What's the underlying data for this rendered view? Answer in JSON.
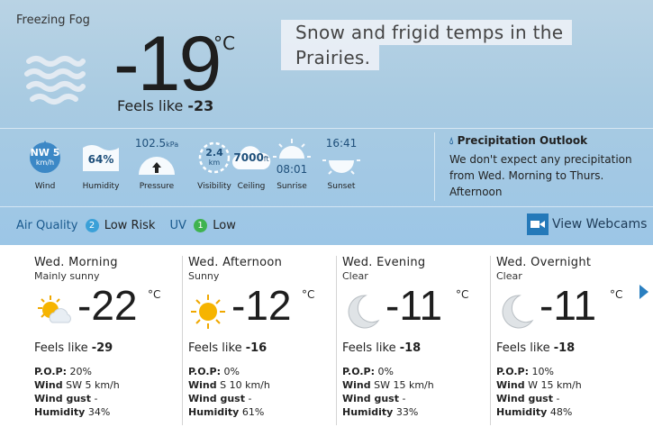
{
  "current": {
    "condition": "Freezing Fog",
    "temperature": "-19",
    "unit": "°C",
    "feels_like_label": "Feels like",
    "feels_like_value": "-23",
    "icon": "fog-icon"
  },
  "headline": {
    "line1": "Snow and frigid temps in the",
    "line2": "Prairies."
  },
  "stats": {
    "wind": {
      "value": "NW 5",
      "unit": "km/h",
      "label": "Wind"
    },
    "humidity": {
      "value": "64%",
      "label": "Humidity"
    },
    "pressure": {
      "value": "102.5",
      "unit": "kPa",
      "label": "Pressure",
      "trend": "rising"
    },
    "visibility": {
      "value": "2.4",
      "unit": "km",
      "label": "Visibility"
    },
    "ceiling": {
      "value": "7000",
      "unit": "ft",
      "label": "Ceiling"
    },
    "sunrise": {
      "value": "08:01",
      "label": "Sunrise"
    },
    "sunset": {
      "value": "16:41",
      "label": "Sunset"
    }
  },
  "precip_outlook": {
    "title": "Precipitation Outlook",
    "text": "We don't expect any precipitation from Wed. Morning to Thurs. Afternoon"
  },
  "air_quality": {
    "label": "Air Quality",
    "index": "2",
    "value": "Low Risk",
    "color": "#3aa0d8"
  },
  "uv": {
    "label": "UV",
    "index": "1",
    "value": "Low",
    "color": "#3fb34f"
  },
  "webcams": {
    "label": "View Webcams"
  },
  "forecast": [
    {
      "title": "Wed. Morning",
      "condition": "Mainly sunny",
      "icon": "sun-cloud-icon",
      "temp": "-22",
      "unit": "°C",
      "feels_label": "Feels like",
      "feels": "-29",
      "pop_label": "P.O.P:",
      "pop": "20%",
      "wind_label": "Wind",
      "wind": "SW 5 km/h",
      "gust_label": "Wind gust",
      "gust": "-",
      "humidity_label": "Humidity",
      "humidity": "34%"
    },
    {
      "title": "Wed. Afternoon",
      "condition": "Sunny",
      "icon": "sun-icon",
      "temp": "-12",
      "unit": "°C",
      "feels_label": "Feels like",
      "feels": "-16",
      "pop_label": "P.O.P:",
      "pop": "0%",
      "wind_label": "Wind",
      "wind": "S 10 km/h",
      "gust_label": "Wind gust",
      "gust": "-",
      "humidity_label": "Humidity",
      "humidity": "61%"
    },
    {
      "title": "Wed. Evening",
      "condition": "Clear",
      "icon": "moon-icon",
      "temp": "-11",
      "unit": "°C",
      "feels_label": "Feels like",
      "feels": "-18",
      "pop_label": "P.O.P:",
      "pop": "0%",
      "wind_label": "Wind",
      "wind": "SW 15 km/h",
      "gust_label": "Wind gust",
      "gust": "-",
      "humidity_label": "Humidity",
      "humidity": "33%"
    },
    {
      "title": "Wed. Overnight",
      "condition": "Clear",
      "icon": "moon-icon",
      "temp": "-11",
      "unit": "°C",
      "feels_label": "Feels like",
      "feels": "-18",
      "pop_label": "P.O.P:",
      "pop": "10%",
      "wind_label": "Wind",
      "wind": "W 15 km/h",
      "gust_label": "Wind gust",
      "gust": "-",
      "humidity_label": "Humidity",
      "humidity": "48%"
    }
  ],
  "colors": {
    "accent": "#2479b9",
    "panel": "#a9cbe2"
  }
}
